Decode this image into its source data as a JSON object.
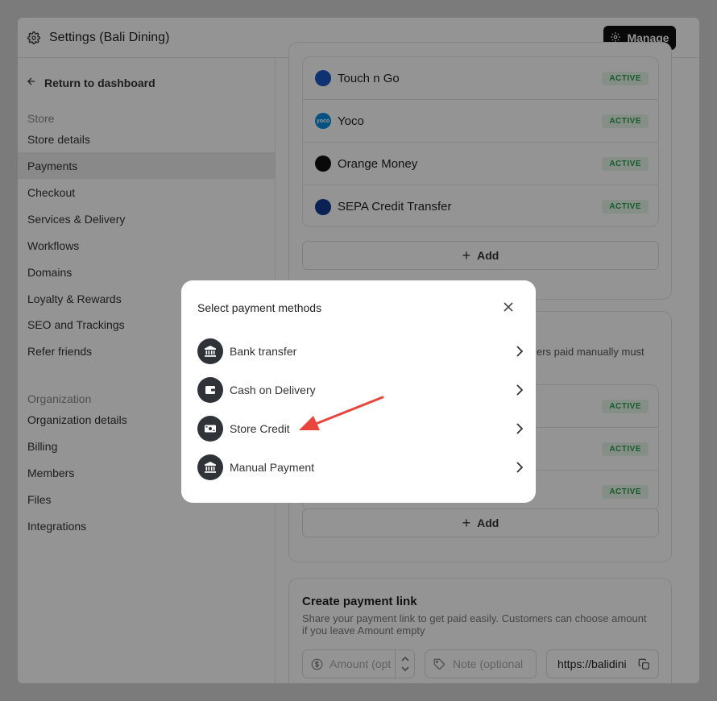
{
  "header": {
    "title": "Settings (Bali Dining)",
    "manage_label": "Manage"
  },
  "sidebar": {
    "back_label": "Return to dashboard",
    "store_label": "Store",
    "store_items": [
      "Store details",
      "Payments",
      "Checkout",
      "Services & Delivery",
      "Workflows",
      "Domains",
      "Loyalty & Rewards",
      "SEO and Trackings",
      "Refer friends"
    ],
    "org_label": "Organization",
    "org_items": [
      "Organization details",
      "Billing",
      "Members",
      "Files",
      "Integrations"
    ]
  },
  "payments": {
    "online": [
      {
        "name": "Touch n Go",
        "status": "ACTIVE",
        "icon": "touchngo-logo",
        "logo_text": ""
      },
      {
        "name": "Yoco",
        "status": "ACTIVE",
        "icon": "yoco-logo",
        "logo_text": "yoco"
      },
      {
        "name": "Orange Money",
        "status": "ACTIVE",
        "icon": "orange-money-logo",
        "logo_text": ""
      },
      {
        "name": "SEPA Credit Transfer",
        "status": "ACTIVE",
        "icon": "sepa-logo",
        "logo_text": ""
      }
    ],
    "add_label": "Add",
    "manual_partial_text": "ers paid manually must",
    "manual_statuses": [
      "ACTIVE",
      "ACTIVE",
      "ACTIVE"
    ],
    "add_label_2": "Add"
  },
  "payment_link": {
    "title": "Create payment link",
    "description": "Share your payment link to get paid easily. Customers can choose amount if you leave Amount empty",
    "amount_placeholder": "Amount (opt",
    "note_placeholder": "Note (optional",
    "url_value": "https://balidini"
  },
  "modal": {
    "title": "Select payment methods",
    "methods": [
      {
        "label": "Bank transfer",
        "icon": "bank-icon"
      },
      {
        "label": "Cash on Delivery",
        "icon": "wallet-icon"
      },
      {
        "label": "Store Credit",
        "icon": "banknote-icon"
      },
      {
        "label": "Manual Payment",
        "icon": "bank-icon"
      }
    ]
  },
  "colors": {
    "accent_active": "#2a9d4a",
    "annotation_arrow": "#e8453c",
    "overlay": "rgba(0,0,0,0.42)"
  }
}
